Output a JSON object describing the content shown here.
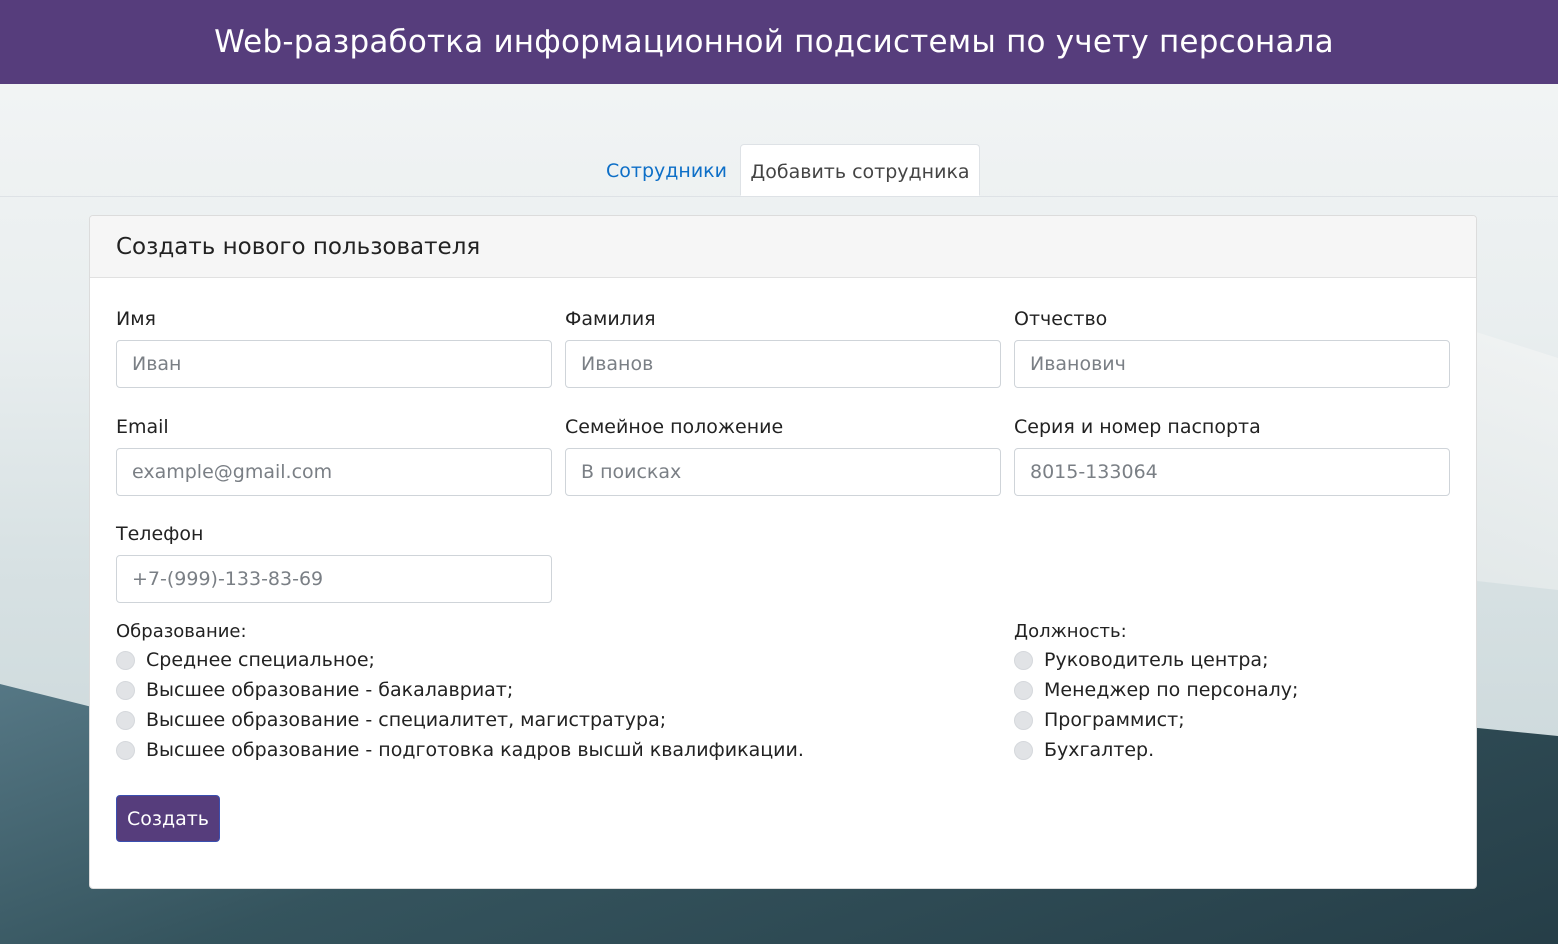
{
  "header": {
    "title": "Web-разработка информационной подсистемы по учету персонала"
  },
  "tabs": [
    {
      "label": "Сотрудники",
      "active": false
    },
    {
      "label": "Добавить сотрудника",
      "active": true
    }
  ],
  "form": {
    "title": "Создать нового пользователя",
    "fields": {
      "first_name": {
        "label": "Имя",
        "placeholder": "Иван"
      },
      "last_name": {
        "label": "Фамилия",
        "placeholder": "Иванов"
      },
      "patronymic": {
        "label": "Отчество",
        "placeholder": "Иванович"
      },
      "email": {
        "label": "Email",
        "placeholder": "example@gmail.com"
      },
      "marital_status": {
        "label": "Семейное положение",
        "placeholder": "В поисках"
      },
      "passport": {
        "label": "Серия и номер паспорта",
        "placeholder": "8015-133064"
      },
      "phone": {
        "label": "Телефон",
        "placeholder": "+7-(999)-133-83-69"
      }
    },
    "education": {
      "title": "Образование:",
      "options": [
        "Среднее специальное;",
        "Высшее образование - бакалавриат;",
        "Высшее образование - специалитет, магистратура;",
        "Высшее образование - подготовка кадров высшй квалификации."
      ]
    },
    "position": {
      "title": "Должность:",
      "options": [
        "Руководитель центра;",
        "Менеджер по персоналу;",
        "Программист;",
        "Бухгалтер."
      ]
    },
    "submit_label": "Создать"
  },
  "colors": {
    "header_bg": "#563d7c",
    "link": "#0d6fc7",
    "button_bg": "#563d7c"
  }
}
